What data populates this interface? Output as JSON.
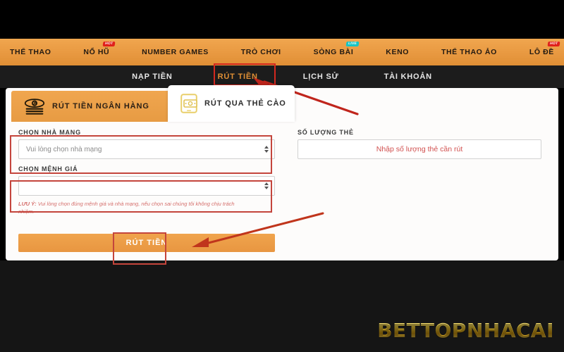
{
  "main_nav": {
    "items": [
      {
        "label": "THỂ THAO",
        "badge": null,
        "badge_kind": null
      },
      {
        "label": "NỔ HŨ",
        "badge": "HOT",
        "badge_kind": "hot"
      },
      {
        "label": "NUMBER GAMES",
        "badge": null,
        "badge_kind": null
      },
      {
        "label": "TRÒ CHƠI",
        "badge": null,
        "badge_kind": null
      },
      {
        "label": "SÒNG BÀI",
        "badge": "LIVE",
        "badge_kind": "live"
      },
      {
        "label": "KENO",
        "badge": null,
        "badge_kind": null
      },
      {
        "label": "THỂ THAO ẢO",
        "badge": null,
        "badge_kind": null
      },
      {
        "label": "LÔ ĐỀ",
        "badge": "HOT",
        "badge_kind": "hot"
      }
    ]
  },
  "sub_nav": {
    "items": [
      {
        "label": "NẠP TIỀN",
        "active": false
      },
      {
        "label": "RÚT TIỀN",
        "active": true
      },
      {
        "label": "LỊCH SỬ",
        "active": false
      },
      {
        "label": "TÀI KHOẢN",
        "active": false
      }
    ]
  },
  "tabs": [
    {
      "label": "RÚT TIỀN NGÂN HÀNG",
      "icon": "cash-stack-icon",
      "active": false
    },
    {
      "label": "RÚT QUA THẺ CÀO",
      "icon": "mobile-card-icon",
      "active": true
    }
  ],
  "form": {
    "carrier": {
      "label": "CHỌN NHÀ MẠNG",
      "placeholder": "Vui lòng chọn nhà mạng",
      "value": ""
    },
    "denomination": {
      "label": "CHỌN MỆNH GIÁ",
      "placeholder": "",
      "value": ""
    },
    "note_prefix": "LƯU Ý:",
    "note_text": " Vui lòng chọn đúng mệnh giá và nhà mạng, nếu chọn sai chúng tôi không chịu trách nhiệm.",
    "quantity": {
      "label": "SỐ LƯỢNG THẺ",
      "placeholder": "Nhập số lượng thẻ cần rút",
      "value": ""
    },
    "submit_label": "RÚT TIỀN"
  },
  "watermark": "BETTOPNHACAI",
  "colors": {
    "brand_orange": "#e89641",
    "nav_orange": "#eda04a",
    "dark_bg": "#151515",
    "highlight_red": "#c4453c",
    "accent_gold": "#f7d23c",
    "badge_hot": "#e0201b",
    "badge_live": "#17c4c4",
    "placeholder_red": "#d1504f"
  }
}
